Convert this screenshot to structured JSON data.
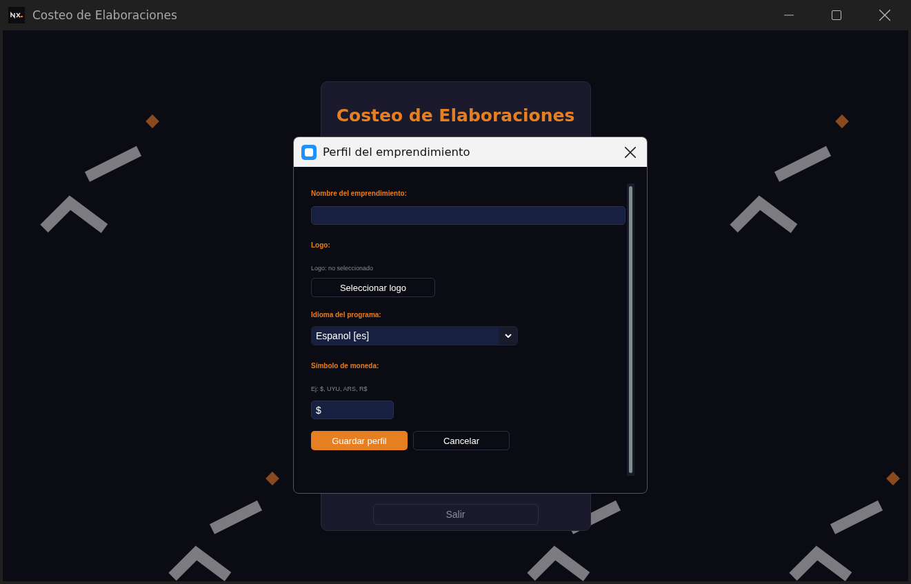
{
  "window": {
    "title": "Costeo de Elaboraciones"
  },
  "main_card": {
    "title": "Costeo de Elaboraciones",
    "exit_button": "Salir"
  },
  "dialog": {
    "title": "Perfil del emprendimiento",
    "business_name": {
      "label": "Nombre del emprendimiento:"
    },
    "logo": {
      "label": "Logo:",
      "status": "Logo: no seleccionado",
      "button": "Seleccionar logo"
    },
    "language": {
      "label": "Idioma del programa:",
      "value": "Espanol [es]"
    },
    "currency": {
      "label": "Símbolo de moneda:",
      "hint": "Ej: $, UYU, ARS, R$",
      "value": "$"
    },
    "buttons": [
      {
        "label": "Guardar perfil",
        "kind": "primary"
      },
      {
        "label": "Cancelar",
        "kind": "secondary"
      }
    ]
  }
}
